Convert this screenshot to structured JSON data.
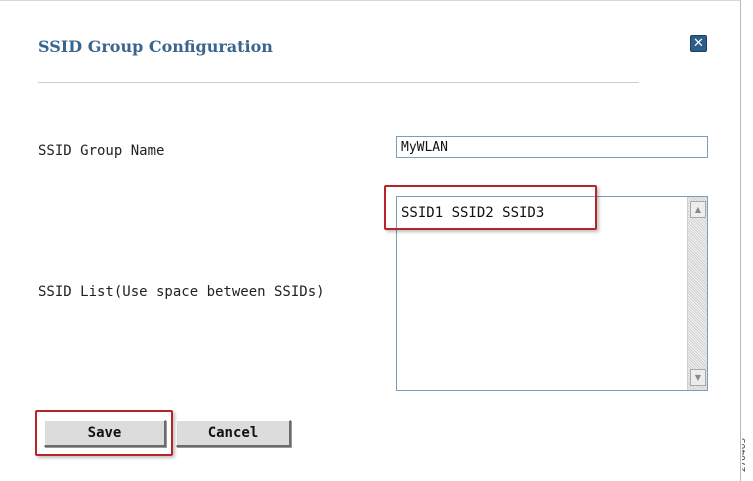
{
  "dialog": {
    "title": "SSID Group Configuration",
    "close_glyph": "✕"
  },
  "form": {
    "group_name_label": "SSID Group Name",
    "group_name_value": "MyWLAN",
    "ssid_list_label": "SSID List(Use space between SSIDs)",
    "ssid_list_value": "SSID1 SSID2 SSID3"
  },
  "buttons": {
    "save_label": "Save",
    "cancel_label": "Cancel"
  },
  "scrollbar": {
    "up_glyph": "▲",
    "down_glyph": "▼"
  },
  "figure_code": "270405",
  "colors": {
    "title": "#39668f",
    "highlight": "#b7242a",
    "close_button": "#2f5d8a"
  }
}
